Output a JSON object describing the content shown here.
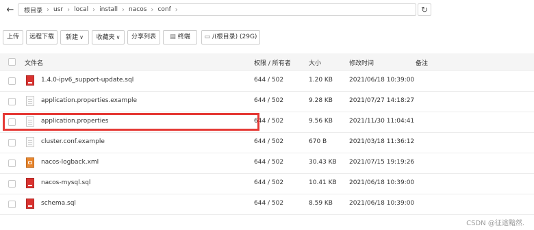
{
  "addressbar": {
    "crumbs": [
      "根目录",
      "usr",
      "local",
      "install",
      "nacos",
      "conf"
    ]
  },
  "toolbar": {
    "upload": "上传",
    "remote_download": "远程下载",
    "new": "新建",
    "favorites": "收藏夹",
    "share_list": "分享列表",
    "terminal": "终端",
    "disk": "/(根目录) (29G)"
  },
  "table": {
    "headers": {
      "name": "文件名",
      "perm": "权限 / 所有者",
      "size": "大小",
      "mtime": "修改时间",
      "note": "备注"
    },
    "rows": [
      {
        "name": "1.4.0-ipv6_support-update.sql",
        "perm": "644 / 502",
        "size": "1.20 KB",
        "mtime": "2021/06/18 10:39:00",
        "icon": "sql-file-icon"
      },
      {
        "name": "application.properties.example",
        "perm": "644 / 502",
        "size": "9.28 KB",
        "mtime": "2021/07/27 14:18:27",
        "icon": "text-file-icon"
      },
      {
        "name": "application.properties",
        "perm": "644 / 502",
        "size": "9.56 KB",
        "mtime": "2021/11/30 11:04:41",
        "icon": "text-file-icon"
      },
      {
        "name": "cluster.conf.example",
        "perm": "644 / 502",
        "size": "670 B",
        "mtime": "2021/03/18 11:36:12",
        "icon": "text-file-icon"
      },
      {
        "name": "nacos-logback.xml",
        "perm": "644 / 502",
        "size": "30.43 KB",
        "mtime": "2021/07/15 19:19:26",
        "icon": "xml-file-icon"
      },
      {
        "name": "nacos-mysql.sql",
        "perm": "644 / 502",
        "size": "10.41 KB",
        "mtime": "2021/06/18 10:39:00",
        "icon": "sql-file-icon"
      },
      {
        "name": "schema.sql",
        "perm": "644 / 502",
        "size": "8.59 KB",
        "mtime": "2021/06/18 10:39:00",
        "icon": "sql-file-icon"
      }
    ]
  },
  "watermark": "CSDN @征途黯然.",
  "colors": {
    "highlight": "#e53935",
    "sql_icon": "#d9322f",
    "xml_icon": "#e8862e"
  }
}
